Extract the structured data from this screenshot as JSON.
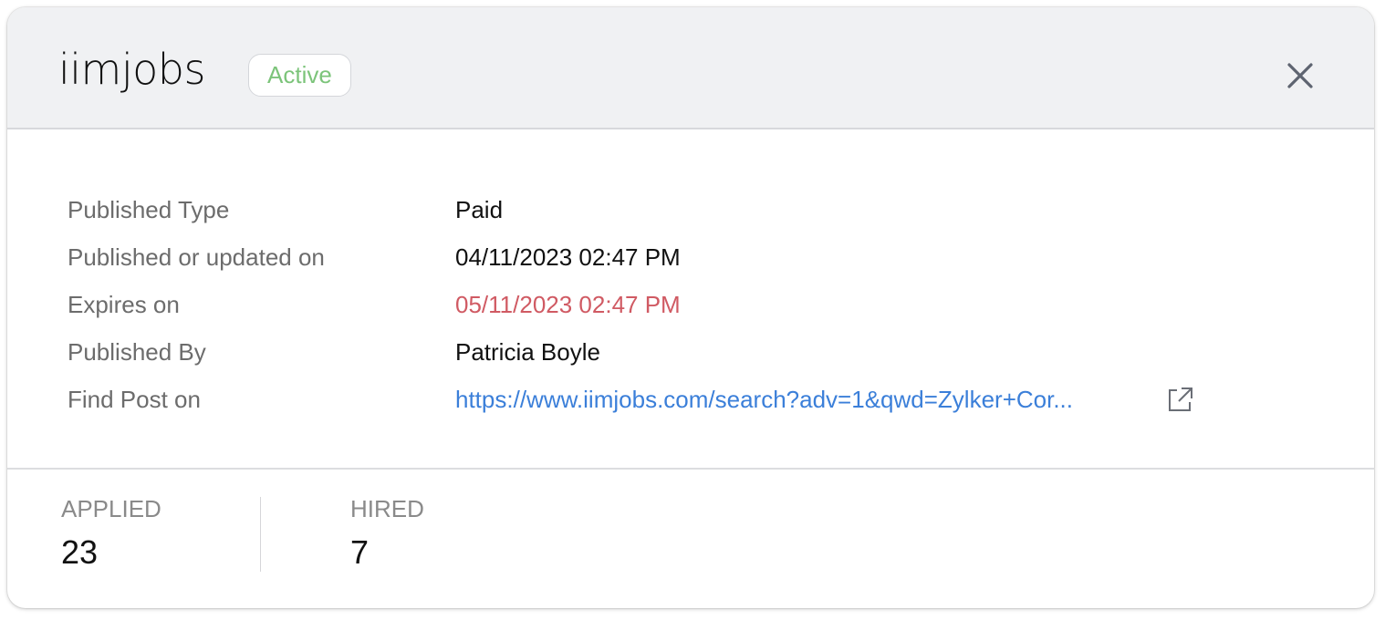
{
  "header": {
    "logo_text": "iimjobs",
    "status_badge": "Active",
    "close_icon": "close-icon"
  },
  "details": {
    "rows": [
      {
        "label": "Published Type",
        "value": "Paid"
      },
      {
        "label": "Published or updated on",
        "value": "04/11/2023 02:47 PM"
      },
      {
        "label": "Expires on",
        "value": "05/11/2023 02:47 PM"
      },
      {
        "label": "Published By",
        "value": "Patricia Boyle"
      },
      {
        "label": "Find Post on",
        "value": "https://www.iimjobs.com/search?adv=1&qwd=Zylker+Cor..."
      }
    ],
    "external_link_icon": "external-link-icon"
  },
  "stats": {
    "applied_label": "APPLIED",
    "applied_value": "23",
    "hired_label": "HIRED",
    "hired_value": "7"
  },
  "colors": {
    "header_bg": "#f0f1f3",
    "active_green": "#7cc47a",
    "expire_red": "#d05a63",
    "link_blue": "#3b7fd9"
  }
}
